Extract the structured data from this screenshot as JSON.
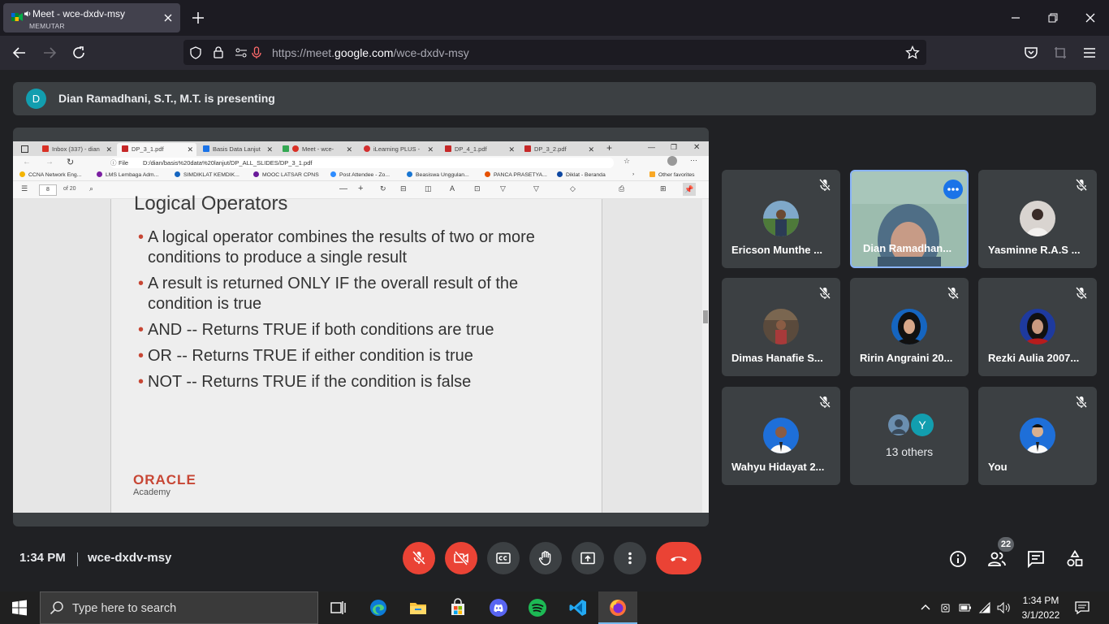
{
  "browser": {
    "tab": {
      "title": "Meet - wce-dxdv-msy",
      "subtitle": "MEMUTAR"
    },
    "url": {
      "host": "https://meet.",
      "domain": "google.com",
      "path": "/wce-dxdv-msy"
    }
  },
  "meet": {
    "presenting": {
      "initial": "D",
      "text": "Dian Ramadhani, S.T., M.T. is presenting"
    },
    "time": "1:34 PM",
    "code": "wce-dxdv-msy",
    "people_count": "22"
  },
  "shared_screen": {
    "tabs": [
      {
        "label": "Inbox (337) - dian",
        "color": "#d93025"
      },
      {
        "label": "DP_3_1.pdf",
        "color": "#c62828"
      },
      {
        "label": "Basis Data Lanjut",
        "color": "#1a73e8"
      },
      {
        "label": "Meet - wce-",
        "color": "#34a853"
      },
      {
        "label": "iLearning PLUS -",
        "color": "#d32f2f"
      },
      {
        "label": "DP_4_1.pdf",
        "color": "#c62828"
      },
      {
        "label": "DP_3_2.pdf",
        "color": "#c62828"
      }
    ],
    "address_prefix": "File",
    "address": "D:/dian/basis%20data%20lanjut/DP_ALL_SLIDES/DP_3_1.pdf",
    "bookmarks": [
      "CCNA Network Eng...",
      "LMS Lembaga Adm...",
      "SIMDIKLAT KEMDIK...",
      "MOOC LATSAR CPNS",
      "Post Attendee - Zo...",
      "Beasiswa Unggulan...",
      "PANCA PRASETYA...",
      "Diklat - Beranda"
    ],
    "other_favorites": "Other favorites",
    "page_number": "8",
    "page_total": "of 20",
    "slide": {
      "title": "Logical Operators",
      "bullets": [
        "A logical operator combines the results of two or more conditions to produce a single result",
        "A result is returned ONLY IF the overall result of the condition is true",
        "AND  --  Returns TRUE if both conditions are true",
        "OR  --  Returns TRUE if either condition is true",
        "NOT  --  Returns TRUE if the condition is false"
      ],
      "logo": "ORACLE",
      "logo_sub": "Academy"
    }
  },
  "participants": [
    {
      "name": "Ericson Munthe ..."
    },
    {
      "name": "Dian Ramadhan..."
    },
    {
      "name": "Yasminne R.A.S ..."
    },
    {
      "name": "Dimas Hanafie S..."
    },
    {
      "name": "Ririn Angraini 20..."
    },
    {
      "name": "Rezki Aulia 2007..."
    },
    {
      "name": "Wahyu Hidayat 2..."
    },
    {
      "name": "13 others",
      "initial": "Y"
    },
    {
      "name": "You"
    }
  ],
  "taskbar": {
    "search_placeholder": "Type here to search",
    "time": "1:34 PM",
    "date": "3/1/2022"
  }
}
